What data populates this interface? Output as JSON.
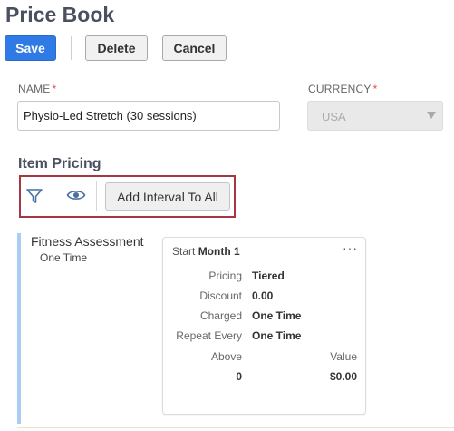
{
  "page": {
    "title": "Price Book"
  },
  "toolbar": {
    "save_label": "Save",
    "delete_label": "Delete",
    "cancel_label": "Cancel"
  },
  "form": {
    "name": {
      "label": "NAME",
      "required_mark": "*",
      "value": "Physio-Led Stretch (30 sessions)"
    },
    "currency": {
      "label": "CURRENCY",
      "required_mark": "*",
      "value": "USA",
      "disabled": true
    }
  },
  "item_pricing": {
    "title": "Item Pricing",
    "toolbar": {
      "filter_icon": "filter-icon",
      "view_icon": "eye-icon",
      "add_interval_label": "Add Interval To All"
    },
    "items": [
      {
        "name": "Fitness Assessment",
        "frequency": "One Time",
        "interval": {
          "start_label": "Start",
          "start_value": "Month 1",
          "menu_glyph": "···",
          "rows": [
            {
              "label": "Pricing",
              "value": "Tiered"
            },
            {
              "label": "Discount",
              "value": "0.00"
            },
            {
              "label": "Charged",
              "value": "One Time"
            },
            {
              "label": "Repeat Every",
              "value": "One Time"
            }
          ],
          "tiers": {
            "above_header": "Above",
            "value_header": "Value",
            "rows": [
              {
                "above": "0",
                "value": "$0.00"
              }
            ]
          }
        }
      }
    ]
  },
  "colors": {
    "primary": "#2f7ae5",
    "highlight": "#a63641",
    "interval_bar": "#a9cdf3",
    "title": "#4a5060"
  }
}
